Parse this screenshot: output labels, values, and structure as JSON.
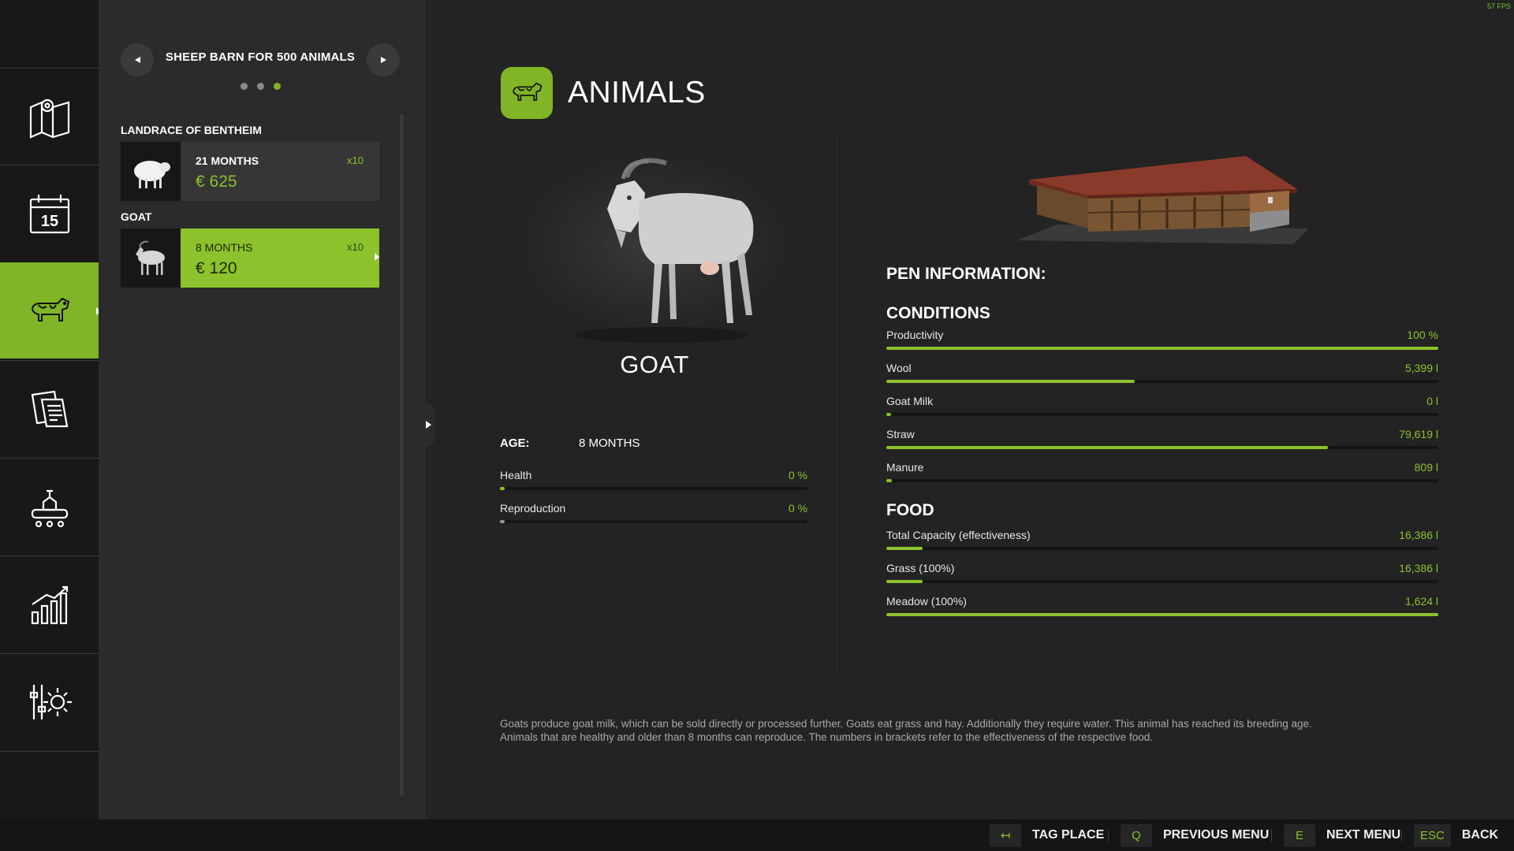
{
  "fps": "57 FPS",
  "nav": {
    "items": [
      {
        "name": "map",
        "icon": "map-icon"
      },
      {
        "name": "calendar",
        "icon": "calendar-icon",
        "badge": "15"
      },
      {
        "name": "animals",
        "icon": "cow-icon",
        "active": true
      },
      {
        "name": "contracts",
        "icon": "documents-icon"
      },
      {
        "name": "production",
        "icon": "factory-icon"
      },
      {
        "name": "statistics",
        "icon": "chart-icon"
      },
      {
        "name": "settings",
        "icon": "settings-gear-icon"
      }
    ]
  },
  "panel": {
    "title": "SHEEP BARN FOR 500 ANIMALS",
    "page_dots": 3,
    "active_dot": 2,
    "groups": [
      {
        "label": "LANDRACE OF BENTHEIM",
        "card": {
          "age": "21 MONTHS",
          "count": "x10",
          "price": "€ 625",
          "thumb_icon": "sheep-icon"
        }
      },
      {
        "label": "GOAT",
        "card": {
          "age": "8 MONTHS",
          "count": "x10",
          "price": "€ 120",
          "thumb_icon": "goat-icon",
          "selected": true
        }
      }
    ]
  },
  "header": {
    "title": "ANIMALS",
    "icon": "cow-icon"
  },
  "animal": {
    "name": "GOAT",
    "age_label": "AGE:",
    "age_value": "8 MONTHS",
    "stats": [
      {
        "label": "Health",
        "value": "0 %",
        "fraction": 0
      },
      {
        "label": "Reproduction",
        "value": "0 %",
        "fraction": 0
      }
    ]
  },
  "pen": {
    "title": "PEN INFORMATION:",
    "conditions_title": "CONDITIONS",
    "conditions": [
      {
        "label": "Productivity",
        "value": "100 %",
        "fraction": 1.0
      },
      {
        "label": "Wool",
        "value": "5,399 l",
        "fraction": 0.45
      },
      {
        "label": "Goat Milk",
        "value": "0 l",
        "fraction": 0
      },
      {
        "label": "Straw",
        "value": "79,619 l",
        "fraction": 0.8
      },
      {
        "label": "Manure",
        "value": "809 l",
        "fraction": 0.01
      }
    ],
    "food_title": "FOOD",
    "food": [
      {
        "label": "Total Capacity (effectiveness)",
        "value": "16,386 l",
        "fraction": 0.065
      },
      {
        "label": "Grass (100%)",
        "value": "16,386 l",
        "fraction": 0.065
      },
      {
        "label": "Meadow (100%)",
        "value": "1,624 l",
        "fraction": 1.0
      }
    ]
  },
  "description": "Goats produce goat milk, which can be sold directly or processed further. Goats eat grass and hay. Additionally they require water. This animal has reached its breeding age. Animals that are healthy and older than 8 months can reproduce. The numbers in brackets refer to the effectiveness of the respective food.",
  "bottom_bar": {
    "hints": [
      {
        "key": "↤",
        "label": "TAG PLACE"
      },
      {
        "key": "Q",
        "label": "PREVIOUS MENU"
      },
      {
        "key": "E",
        "label": "NEXT MENU"
      },
      {
        "key": "ESC",
        "label": "BACK"
      }
    ]
  },
  "colors": {
    "accent": "#7fb526",
    "accent_bright": "#8cc22c",
    "background": "#232323",
    "panel": "#2b2b2b",
    "nav": "#181818"
  }
}
